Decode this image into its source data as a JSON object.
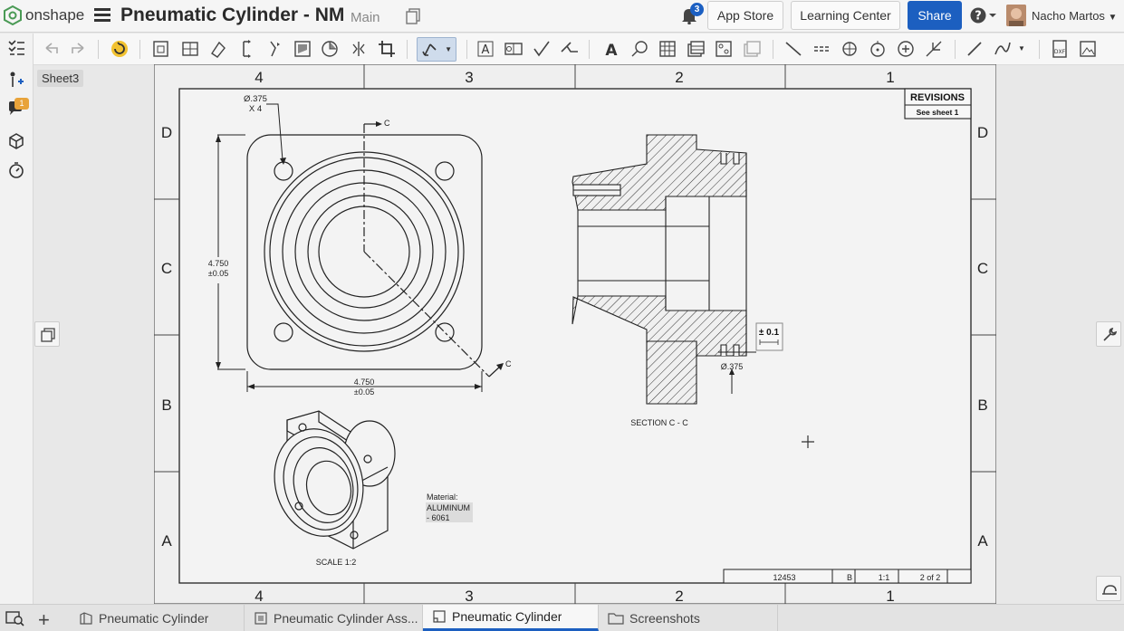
{
  "app": {
    "brand": "onshape",
    "title": "Pneumatic Cylinder - NM",
    "branch": "Main",
    "notification_count": "3",
    "buttons": {
      "app_store": "App Store",
      "learning_center": "Learning Center",
      "share": "Share"
    },
    "user": "Nacho Martos",
    "accent": "#1c5fc0"
  },
  "left_panel": {
    "comments_badge": "1",
    "sheet": "Sheet3"
  },
  "drawing": {
    "zone_columns": [
      "4",
      "3",
      "2",
      "1"
    ],
    "zone_rows": [
      "D",
      "C",
      "B",
      "A"
    ],
    "revisions": {
      "title": "REVISIONS",
      "note": "See sheet 1"
    },
    "hole_callout": {
      "diameter": "Ø.375",
      "count": "X 4"
    },
    "section_marker": "C",
    "dim_vertical": {
      "value": "4.750",
      "tol": "±0.05"
    },
    "dim_horizontal": {
      "value": "4.750",
      "tol": "±0.05"
    },
    "section_view": {
      "label": "SECTION C - C",
      "diameter": "Ø.375",
      "tolerance_box": "± 0.1"
    },
    "iso_view": {
      "scale": "SCALE 1:2"
    },
    "material": {
      "label": "Material:",
      "value_line1": "ALUMINUM",
      "value_line2": "- 6061"
    },
    "title_block": {
      "dwg_no": "12453",
      "size": "B",
      "scale": "1:1",
      "sheet": "2 of 2"
    }
  },
  "tabs": [
    {
      "label": "Pneumatic Cylinder",
      "icon": "part-studio-icon"
    },
    {
      "label": "Pneumatic Cylinder Ass...",
      "icon": "assembly-icon"
    },
    {
      "label": "Pneumatic Cylinder",
      "icon": "drawing-icon",
      "active": true
    },
    {
      "label": "Screenshots",
      "icon": "folder-icon"
    }
  ]
}
